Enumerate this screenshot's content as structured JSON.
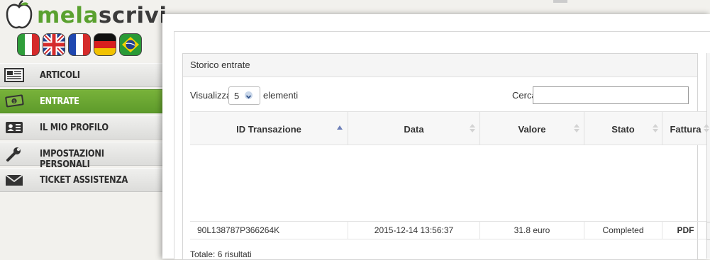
{
  "logo": {
    "part1": "mela",
    "part2": "scrivi"
  },
  "languages": [
    "it",
    "gb",
    "fr",
    "de",
    "br"
  ],
  "nav": [
    {
      "label": "ARTICOLI",
      "icon": "newspaper-icon",
      "active": false
    },
    {
      "label": "ENTRATE",
      "icon": "money-icon",
      "active": true
    },
    {
      "label": "IL MIO PROFILO",
      "icon": "id-card-icon",
      "active": false
    },
    {
      "label": "IMPOSTAZIONI PERSONALI",
      "icon": "wrench-icon",
      "active": false
    },
    {
      "label": "TICKET ASSISTENZA",
      "icon": "envelope-icon",
      "active": false
    }
  ],
  "panel": {
    "title": "Storico entrate"
  },
  "controls": {
    "show_label": "Visualizza",
    "show_value": "5",
    "show_suffix": "elementi",
    "search_label": "Cerca",
    "search_value": ""
  },
  "table": {
    "headers": [
      "ID Transazione",
      "Data",
      "Valore",
      "Stato",
      "Fattura"
    ],
    "rows": [
      [
        "90L138787P366264K",
        "2015-12-14 13:56:37",
        "31.8 euro",
        "Completed",
        "PDF"
      ]
    ]
  },
  "footer": {
    "total": "Totale: 6 risultati"
  },
  "colors": {
    "accent": "#6aa832",
    "panel_header": "#f5f5f5"
  }
}
